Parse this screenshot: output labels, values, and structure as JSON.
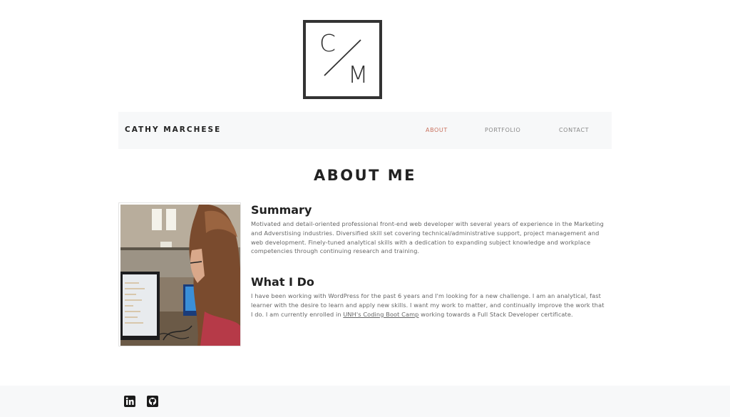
{
  "logo": {
    "letter_top": "C",
    "letter_bottom": "M"
  },
  "nav": {
    "brand": "CATHY MARCHESE",
    "links": [
      {
        "label": "ABOUT",
        "active": true
      },
      {
        "label": "PORTFOLIO",
        "active": false
      },
      {
        "label": "CONTACT",
        "active": false
      }
    ],
    "active_color": "#c9725f"
  },
  "about": {
    "title": "ABOUT ME",
    "summary_heading": "Summary",
    "summary_text": "Motivated and detail-oriented professional front-end web developer with several years of experience in the Marketing and Adverstising industries. Diversified skill set covering technical/administrative support, project management and web development. Finely-tuned analytical skills with a dedication to expanding subject knowledge and workplace competencies through continuing research and training.",
    "whatido_heading": "What I Do",
    "whatido_before_link": "I have been working with WordPress for the past 6 years and I'm looking for a new challenge. I am an analytical, fast learner with the desire to learn and apply new skills. I want my work to matter, and continually improve the work that I do. I am currently enrolled in ",
    "whatido_link": "UNH's Coding Boot Camp",
    "whatido_after_link": " working towards a Full Stack Developer certificate."
  },
  "footer": {
    "icons": [
      "linkedin-icon",
      "github-icon"
    ]
  }
}
